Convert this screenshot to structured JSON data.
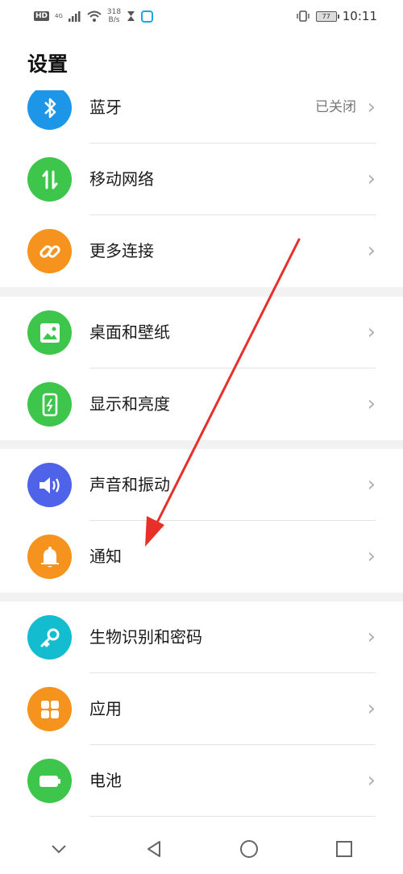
{
  "status": {
    "hd": "HD",
    "network": "4G",
    "speed_value": "318",
    "speed_unit": "B/s",
    "battery": "77",
    "time": "10:11"
  },
  "page_title": "设置",
  "groups": [
    {
      "items": [
        {
          "label": "蓝牙",
          "value": "已关闭",
          "icon": "bluetooth-icon",
          "color": "#1e96e8"
        },
        {
          "label": "移动网络",
          "icon": "mobile-data-icon",
          "color": "#3ec54b"
        },
        {
          "label": "更多连接",
          "icon": "link-icon",
          "color": "#f5931e"
        }
      ]
    },
    {
      "items": [
        {
          "label": "桌面和壁纸",
          "icon": "image-icon",
          "color": "#3ec54b"
        },
        {
          "label": "显示和亮度",
          "icon": "display-icon",
          "color": "#3ec54b"
        }
      ]
    },
    {
      "items": [
        {
          "label": "声音和振动",
          "icon": "speaker-icon",
          "color": "#4f63e8"
        },
        {
          "label": "通知",
          "icon": "bell-icon",
          "color": "#f5931e"
        }
      ]
    },
    {
      "items": [
        {
          "label": "生物识别和密码",
          "icon": "key-icon",
          "color": "#14bcd0"
        },
        {
          "label": "应用",
          "icon": "apps-grid-icon",
          "color": "#f5931e"
        },
        {
          "label": "电池",
          "icon": "battery-icon",
          "color": "#3ec54b"
        }
      ]
    }
  ],
  "annotation_arrow_color": "#e8302a",
  "nav_icons": [
    "chevron-down-icon",
    "back-icon",
    "home-icon",
    "recents-icon"
  ]
}
